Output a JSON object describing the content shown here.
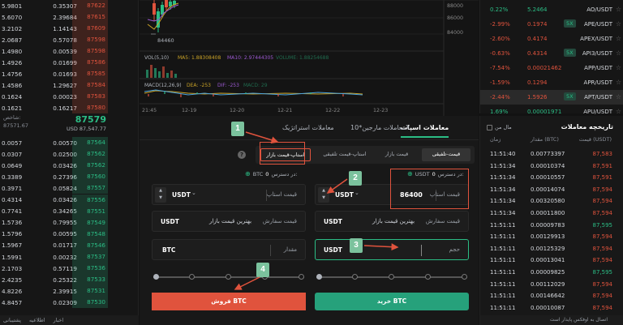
{
  "orderbook": {
    "asks": [
      [
        "5.9801",
        "0.35307",
        "87622"
      ],
      [
        "5.6070",
        "2.39684",
        "87615"
      ],
      [
        "3.2102",
        "1.14143",
        "87609"
      ],
      [
        "2.0687",
        "0.57078",
        "87598"
      ],
      [
        "1.4980",
        "0.00539",
        "87598"
      ],
      [
        "1.4926",
        "0.01699",
        "87586"
      ],
      [
        "1.4756",
        "0.01693",
        "87585"
      ],
      [
        "1.4586",
        "1.29627",
        "87584"
      ],
      [
        "0.1624",
        "0.00023",
        "87583"
      ],
      [
        "0.1621",
        "0.16217",
        "87580"
      ]
    ],
    "mid_label": "شاخص:",
    "mid_sub": "87571.67",
    "mid_price": "87579",
    "mid_usd": "USD 87,547.77",
    "bids": [
      [
        "0.0057",
        "0.00570",
        "87564"
      ],
      [
        "0.0307",
        "0.02500",
        "87562"
      ],
      [
        "0.0649",
        "0.03426",
        "87562"
      ],
      [
        "0.3389",
        "0.27396",
        "87560"
      ],
      [
        "0.3971",
        "0.05824",
        "87557"
      ],
      [
        "0.4314",
        "0.03426",
        "87556"
      ],
      [
        "0.7741",
        "0.34265",
        "87551"
      ],
      [
        "1.5736",
        "0.79955",
        "87549"
      ],
      [
        "1.5796",
        "0.00595",
        "87548"
      ],
      [
        "1.5967",
        "0.01717",
        "87546"
      ],
      [
        "1.5991",
        "0.00232",
        "87537"
      ],
      [
        "2.1703",
        "0.57119",
        "87536"
      ],
      [
        "2.4235",
        "0.25322",
        "87533"
      ],
      [
        "4.8226",
        "2.39915",
        "87531"
      ],
      [
        "4.8457",
        "0.02309",
        "87530"
      ]
    ],
    "footer": [
      "پشتیبانی",
      "اطلاعیه",
      "اخبار"
    ]
  },
  "chart": {
    "low_label": "84460",
    "vol_label": "VOL(5,10)",
    "ma5_label": "MA5: 1.88308408",
    "ma10_label": "MA10: 2.97444305",
    "volume_label": "VOLUME: 1.88254688",
    "macd_label": "MACD(12,26,9)",
    "dea_label": "DEA: -253",
    "dif_label": "DIF: -253",
    "macd_val_label": "MACD: 29",
    "x_ticks": [
      "21:45",
      "12-19",
      "12-20",
      "12-21",
      "12-22",
      "12-23"
    ],
    "y_ticks": [
      "88000",
      "86000",
      "84000"
    ]
  },
  "markets": [
    {
      "change": "0.22%",
      "dir": "up",
      "price": "5.2464",
      "lev": "",
      "symbol": "AO/USDT"
    },
    {
      "change": "-2.99%",
      "dir": "down",
      "price": "0.1974",
      "lev": "5X",
      "symbol": "APE/USDT"
    },
    {
      "change": "-2.60%",
      "dir": "down",
      "price": "0.4174",
      "lev": "",
      "symbol": "APEX/USDT"
    },
    {
      "change": "-0.63%",
      "dir": "down",
      "price": "0.4314",
      "lev": "5X",
      "symbol": "API3/USDT"
    },
    {
      "change": "-7.54%",
      "dir": "down",
      "price": "0.00021462",
      "lev": "",
      "symbol": "APP/USDT"
    },
    {
      "change": "-1.59%",
      "dir": "down",
      "price": "0.1294",
      "lev": "",
      "symbol": "APR/USDT"
    },
    {
      "change": "-2.44%",
      "dir": "down",
      "price": "1.5926",
      "lev": "5X",
      "symbol": "APT/USDT"
    },
    {
      "change": "1.69%",
      "dir": "up",
      "price": "0.00001971",
      "lev": "",
      "symbol": "APU/USDT"
    }
  ],
  "trade": {
    "tab_spot": "معاملات اسپات",
    "tab_margin": "معاملات مارجین",
    "tab_margin_lev": "10X",
    "tab_strategy": "معاملات استراتژیک",
    "order_types": [
      "قیمت-تلفیقی",
      "قیمت بازار",
      "استاپ-قیمت تلفیقی",
      "استاپ-قیمت بازار"
    ],
    "help": "?",
    "buy_avail_label": "در دسترس:",
    "buy_avail_num": "0",
    "buy_avail_unit": "USDT",
    "sell_avail_label": "در دسترس:",
    "sell_avail_num": "0",
    "sell_avail_unit": "BTC",
    "buy_stop_unit": "USDT",
    "buy_stop_value": "86400",
    "buy_stop_label": "قیمت استاپ",
    "sell_stop_unit": "USDT",
    "sell_stop_label": "قیمت استاپ",
    "buy_order_unit": "USDT",
    "buy_order_best": "بهترین قیمت بازار",
    "buy_order_label": "قیمت سفارش",
    "sell_order_unit": "USDT",
    "sell_order_best": "بهترین قیمت بازار",
    "sell_order_label": "قیمت سفارش",
    "buy_volume_unit": "USDT",
    "buy_volume_label": "حجم",
    "sell_amount_unit": "BTC",
    "sell_amount_label": "مقدار",
    "buy_button": "خرید BTC",
    "sell_button": "فروش BTC"
  },
  "annotations": [
    "1",
    "2",
    "3",
    "4"
  ],
  "history": {
    "title": "تاریخچه معاملات",
    "toggle": "مال من",
    "col_price": "قیمت (USDT)",
    "col_amount": "مقدار (BTC)",
    "col_time": "زمان",
    "rows": [
      [
        "11:51:40",
        "0.00773397",
        "87,583",
        "down"
      ],
      [
        "11:51:34",
        "0.00010374",
        "87,591",
        "down"
      ],
      [
        "11:51:34",
        "0.00010557",
        "87,591",
        "down"
      ],
      [
        "11:51:34",
        "0.00014074",
        "87,594",
        "down"
      ],
      [
        "11:51:34",
        "0.00320580",
        "87,594",
        "down"
      ],
      [
        "11:51:34",
        "0.00011800",
        "87,594",
        "down"
      ],
      [
        "11:51:11",
        "0.00009783",
        "87,595",
        "up"
      ],
      [
        "11:51:11",
        "0.00129913",
        "87,594",
        "down"
      ],
      [
        "11:51:11",
        "0.00125329",
        "87,594",
        "down"
      ],
      [
        "11:51:11",
        "0.00013041",
        "87,594",
        "down"
      ],
      [
        "11:51:11",
        "0.00009825",
        "87,595",
        "up"
      ],
      [
        "11:51:11",
        "0.00112029",
        "87,594",
        "down"
      ],
      [
        "11:51:11",
        "0.00146642",
        "87,594",
        "down"
      ],
      [
        "11:51:11",
        "0.00010087",
        "87,594",
        "down"
      ]
    ],
    "footer": "اتصال به اوفکس پایدار است"
  },
  "colors": {
    "up": "#2bbd85",
    "down": "#e0533d",
    "accent": "#26a17b"
  }
}
